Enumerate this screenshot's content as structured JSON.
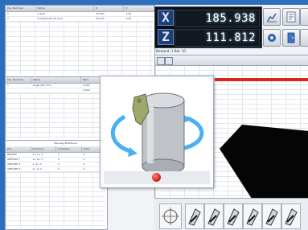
{
  "dro": {
    "axes": [
      {
        "letter": "X",
        "value": "185.938"
      },
      {
        "letter": "Z",
        "value": "111.812"
      }
    ]
  },
  "status_text": "Bestand: 1    Bel: 10",
  "top_table": {
    "headers": [
      "Pos. Nummer",
      "Name",
      "D",
      "V"
    ],
    "rows": [
      [
        "1",
        "5 Stab",
        "05.000",
        "0.00"
      ],
      [
        "2",
        "Schaltwinkel 20 Grad",
        "05.000",
        "0.00"
      ]
    ]
  },
  "mid_table": {
    "headers": [
      "Pos. Nummer",
      "Name",
      "Wert"
    ],
    "rows": [
      [
        "1",
        "Kugel (Ø5 mm)",
        "0.000"
      ],
      [
        "",
        "",
        "0.000"
      ]
    ]
  },
  "bottom_table": {
    "title": "Fahrweg Positionen",
    "headers": [
      "Pos.",
      "Richtung",
      "X Position",
      "Z Pos"
    ],
    "rows": [
      [
        "BEGINN",
        "X+ 2+ V",
        "0",
        "0"
      ],
      [
        "ABFAHRT 1",
        "X+ Z+ V",
        "0",
        "0"
      ],
      [
        "ABFAHRT 2",
        "X- Z+ V",
        "0",
        "0"
      ],
      [
        "ABFAHRT 3",
        "X+ Z- V",
        "0",
        "0"
      ]
    ]
  },
  "colors": {
    "frame": "#2c6fbf",
    "dro_background": "#0b0f14",
    "rotate_arrow": "#4ab0f0",
    "close_button": "#d0281e",
    "part_metal": "#c4c8cd"
  },
  "icons": [
    "toolbar-chart-icon",
    "toolbar-list-icon",
    "toolbar-gear-icon",
    "toolbar-door-icon",
    "rotate-arrow-icon",
    "close-button-icon",
    "crosshair-icon",
    "tool-icon"
  ]
}
